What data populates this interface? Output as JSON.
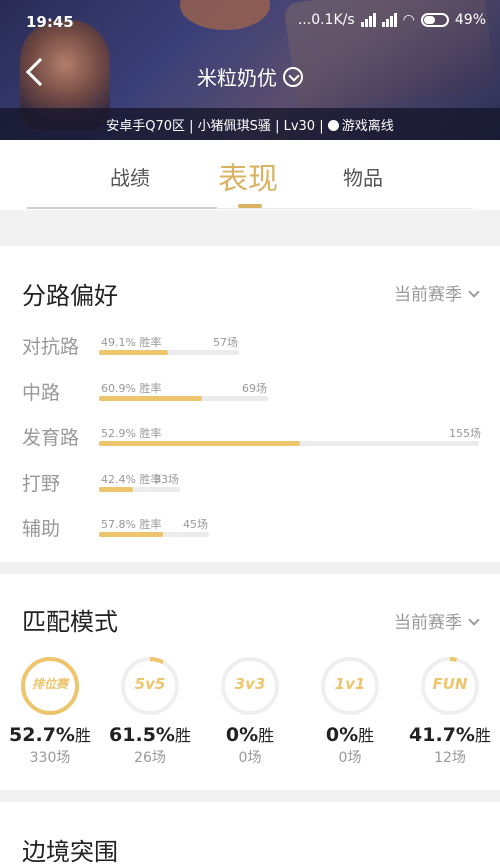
{
  "status_bar": {
    "time": "19:45",
    "network_speed": "...0.1K/s",
    "battery": "49%"
  },
  "header": {
    "title": "米粒奶优",
    "info": "安卓手Q70区 | 小猪佩琪S骚 | Lv30 |",
    "status": "游戏离线"
  },
  "tabs": [
    {
      "label": "战绩"
    },
    {
      "label": "表现"
    },
    {
      "label": "物品"
    }
  ],
  "lane_pref": {
    "title": "分路偏好",
    "season": "当前赛季",
    "lanes": [
      {
        "name": "对抗路",
        "rate": "49.1% 胜率",
        "count": "57场",
        "games": 57,
        "win_rate": 0.491
      },
      {
        "name": "中路",
        "rate": "60.9% 胜率",
        "count": "69场",
        "games": 69,
        "win_rate": 0.609
      },
      {
        "name": "发育路",
        "rate": "52.9% 胜率",
        "count": "155场",
        "games": 155,
        "win_rate": 0.529
      },
      {
        "name": "打野",
        "rate": "42.4% 胜率",
        "count": "33场",
        "games": 33,
        "win_rate": 0.424
      },
      {
        "name": "辅助",
        "rate": "57.8% 胜率",
        "count": "45场",
        "games": 45,
        "win_rate": 0.578
      }
    ]
  },
  "match_mode": {
    "title": "匹配模式",
    "season": "当前赛季",
    "win_suffix": "胜",
    "modes": [
      {
        "icon": "排位赛",
        "pct": "52.7%",
        "games": "330场",
        "share": 1.0
      },
      {
        "icon": "5v5",
        "pct": "61.5%",
        "games": "26场",
        "share": 0.08
      },
      {
        "icon": "3v3",
        "pct": "0%",
        "games": "0场",
        "share": 0.0
      },
      {
        "icon": "1v1",
        "pct": "0%",
        "games": "0场",
        "share": 0.0
      },
      {
        "icon": "FUN",
        "pct": "41.7%",
        "games": "12场",
        "share": 0.04
      }
    ]
  },
  "border_breakout": {
    "title": "边境突围"
  },
  "colors": {
    "accent": "#d9b262",
    "bar": "#ecc56d",
    "muted": "#999999"
  }
}
